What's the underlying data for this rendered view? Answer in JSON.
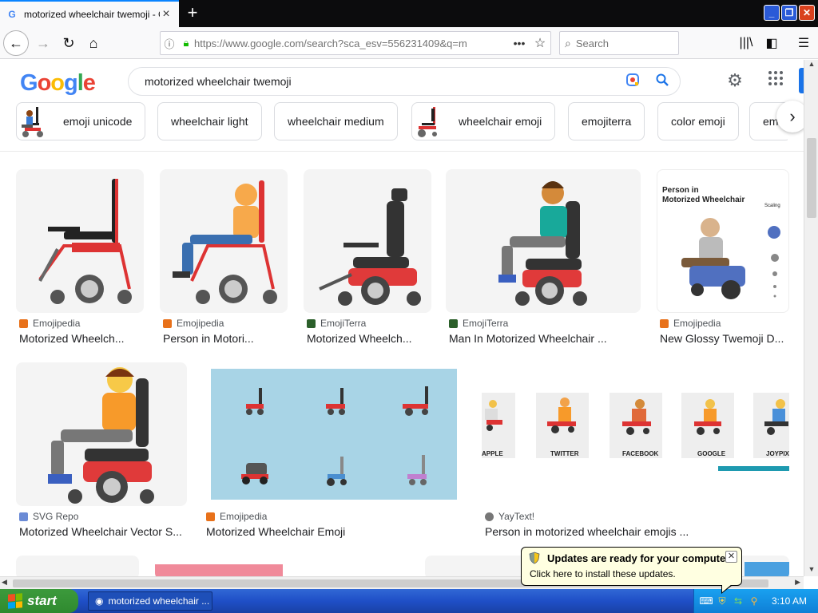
{
  "browser": {
    "tab_title": "motorized wheelchair twemoji - Go",
    "url": "https://www.google.com/search?sca_esv=556231409&q=m",
    "search_placeholder": "Search",
    "favicon_letter": "G"
  },
  "google": {
    "logo_letters": [
      "G",
      "o",
      "o",
      "g",
      "l",
      "e"
    ],
    "logo_colors": [
      "#4285f4",
      "#ea4335",
      "#fbbc05",
      "#4285f4",
      "#34a853",
      "#ea4335"
    ],
    "query": "motorized wheelchair twemoji"
  },
  "chips": [
    {
      "label": "emoji unicode",
      "thumb": true
    },
    {
      "label": "wheelchair light",
      "thumb": false
    },
    {
      "label": "wheelchair medium",
      "thumb": false
    },
    {
      "label": "wheelchair emoji",
      "thumb": true
    },
    {
      "label": "emojiterra",
      "thumb": false
    },
    {
      "label": "color emoji",
      "thumb": false
    },
    {
      "label": "em",
      "thumb": false
    }
  ],
  "results_row1": [
    {
      "source": "Emojipedia",
      "title": "Motorized Wheelch...",
      "source_color": "#e8711a"
    },
    {
      "source": "Emojipedia",
      "title": "Person in Motori...",
      "source_color": "#e8711a"
    },
    {
      "source": "EmojiTerra",
      "title": "Motorized Wheelch...",
      "source_color": "#2b5f2a"
    },
    {
      "source": "EmojiTerra",
      "title": "Man In Motorized Wheelchair ...",
      "source_color": "#2b5f2a"
    },
    {
      "source": "Emojipedia",
      "title": "New Glossy Twemoji D...",
      "source_color": "#e8711a"
    }
  ],
  "results_row2": [
    {
      "source": "SVG Repo",
      "title": "Motorized Wheelchair Vector S...",
      "source_color": "#6b8bd6"
    },
    {
      "source": "Emojipedia",
      "title": "Motorized Wheelchair Emoji",
      "source_color": "#e8711a"
    },
    {
      "source": "YayText!",
      "title": "Person in motorized wheelchair emojis ...",
      "source_color": "#555555"
    }
  ],
  "thumb_text": {
    "glossy_title_1": "Person in",
    "glossy_title_2": "Motorized Wheelchair",
    "glossy_scaling": "Scaling",
    "yay_labels": [
      "APPLE",
      "TWITTER",
      "FACEBOOK",
      "GOOGLE",
      "JOYPIXE"
    ]
  },
  "balloon": {
    "title": "Updates are ready for your computer",
    "body": "Click here to install these updates."
  },
  "taskbar": {
    "start": "start",
    "task": "motorized wheelchair ...",
    "clock": "3:10 AM"
  }
}
